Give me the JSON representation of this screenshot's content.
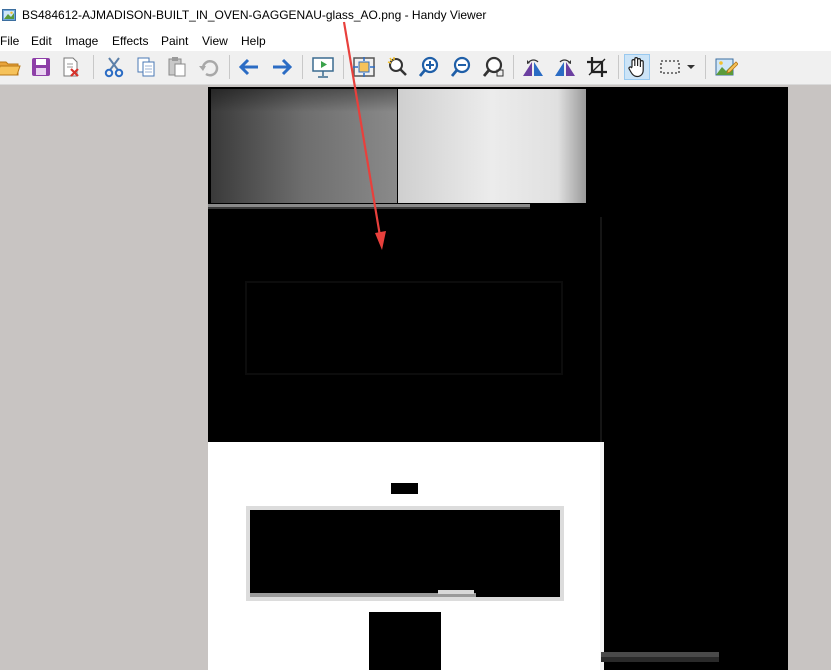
{
  "window": {
    "title": "BS484612-AJMADISON-BUILT_IN_OVEN-GAGGENAU-glass_AO.png - Handy Viewer",
    "app_icon": "image-viewer-icon"
  },
  "menu": {
    "items": [
      "File",
      "Edit",
      "Image",
      "Effects",
      "Paint",
      "View",
      "Help"
    ]
  },
  "toolbar": {
    "buttons": [
      {
        "name": "open-folder-icon"
      },
      {
        "name": "save-icon"
      },
      {
        "name": "close-file-icon"
      },
      {
        "name": "cut-icon"
      },
      {
        "name": "copy-icon"
      },
      {
        "name": "paste-icon"
      },
      {
        "name": "undo-icon"
      },
      {
        "name": "back-arrow-icon"
      },
      {
        "name": "forward-arrow-icon"
      },
      {
        "name": "slideshow-icon"
      },
      {
        "name": "fit-to-window-icon"
      },
      {
        "name": "zoom-auto-icon"
      },
      {
        "name": "zoom-in-icon"
      },
      {
        "name": "zoom-out-icon"
      },
      {
        "name": "zoom-actual-icon"
      },
      {
        "name": "rotate-left-icon"
      },
      {
        "name": "rotate-right-icon"
      },
      {
        "name": "crop-icon"
      },
      {
        "name": "hand-pan-icon"
      },
      {
        "name": "selection-icon"
      },
      {
        "name": "edit-image-icon"
      }
    ]
  },
  "colors": {
    "workspace_bg": "#c8c4c2",
    "image_bg": "#000000",
    "annotation_arrow": "#e8403c",
    "accent_blue": "#2b6cc4"
  }
}
